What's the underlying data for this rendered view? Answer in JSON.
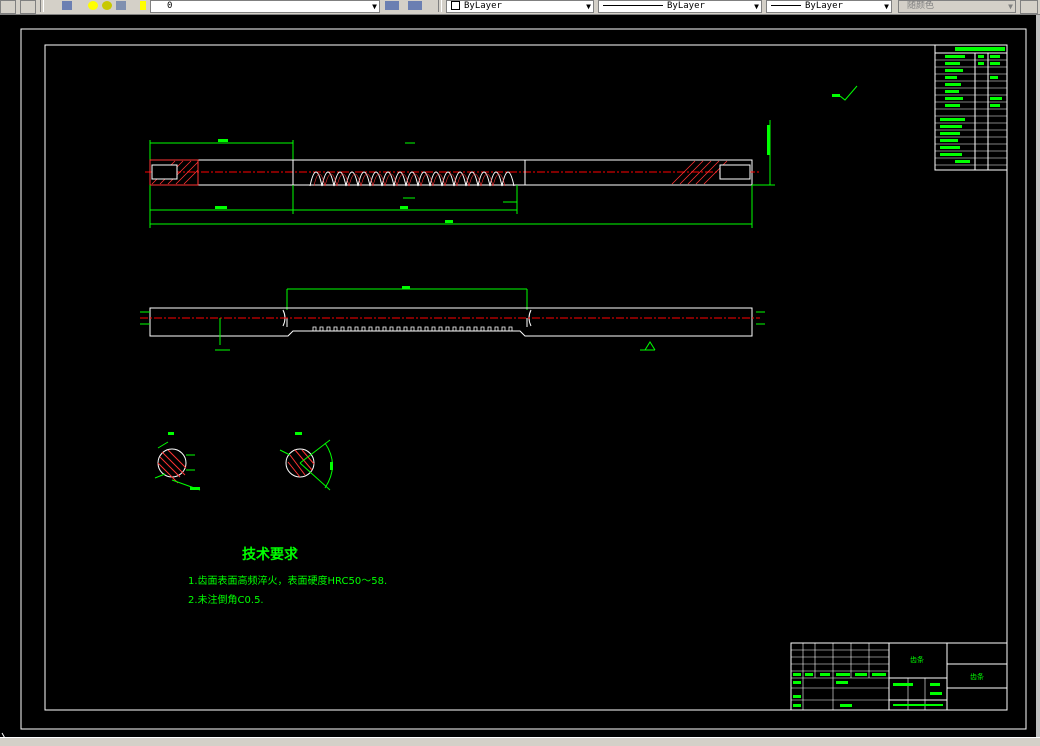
{
  "toolbar": {
    "layer_value": "0",
    "color_value": "ByLayer",
    "linetype_value": "ByLayer",
    "lineweight_value": "ByLayer",
    "plotstyle_value": "随颜色"
  },
  "drawing": {
    "tech_title": "技术要求",
    "tech_req_1": "1.齿面表面高频淬火，表面硬度HRC50～58.",
    "tech_req_2": "2.未注倒角C0.5.",
    "title_block_name": "齿条",
    "title_block_part": "齿条"
  },
  "colors": {
    "background": "#000000",
    "outline": "#ffffff",
    "dimension": "#00ff00",
    "centerline": "#ff0000",
    "hatch": "#ff0000",
    "toolbar": "#d4d0c8"
  }
}
